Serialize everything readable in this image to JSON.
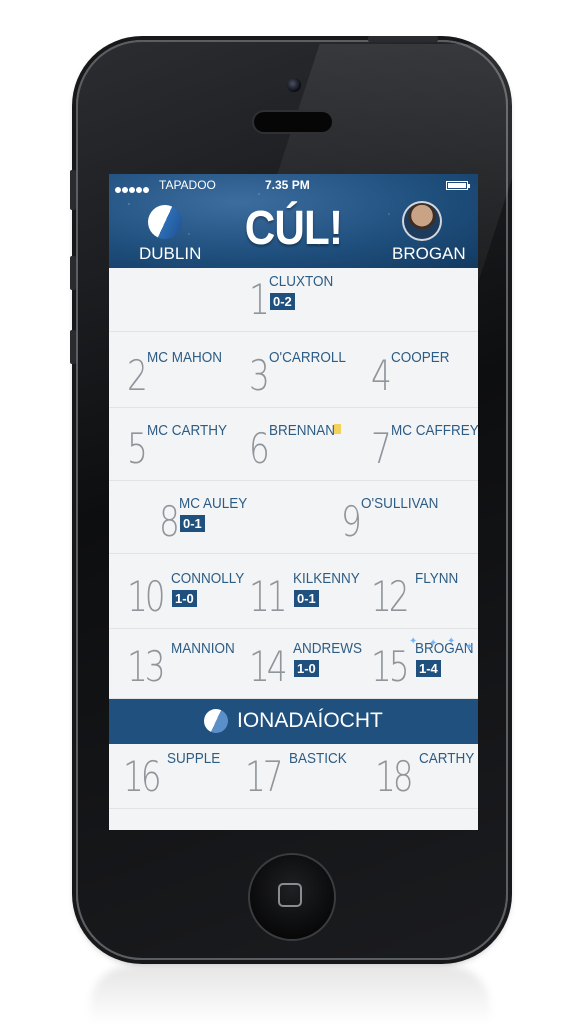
{
  "status": {
    "carrier": "TAPADOO",
    "time": "7.35 PM"
  },
  "header": {
    "title": "CÚL!",
    "team": "DUBLIN",
    "player": "BROGAN"
  },
  "lineup": [
    [
      {
        "n": "1",
        "name": "CLUXTON",
        "score": "0-2"
      }
    ],
    [
      {
        "n": "2",
        "name": "MC MAHON"
      },
      {
        "n": "3",
        "name": "O'CARROLL"
      },
      {
        "n": "4",
        "name": "COOPER"
      }
    ],
    [
      {
        "n": "5",
        "name": "MC CARTHY"
      },
      {
        "n": "6",
        "name": "BRENNAN",
        "card": "yellow"
      },
      {
        "n": "7",
        "name": "MC CAFFREY"
      }
    ],
    [
      {
        "n": "8",
        "name": "MC AULEY",
        "score": "0-1"
      },
      {
        "n": "9",
        "name": "O'SULLIVAN"
      }
    ],
    [
      {
        "n": "10",
        "name": "CONNOLLY",
        "score": "1-0"
      },
      {
        "n": "11",
        "name": "KILKENNY",
        "score": "0-1"
      },
      {
        "n": "12",
        "name": "FLYNN"
      }
    ],
    [
      {
        "n": "13",
        "name": "MANNION"
      },
      {
        "n": "14",
        "name": "ANDREWS",
        "score": "1-0"
      },
      {
        "n": "15",
        "name": "BROGAN",
        "score": "1-4",
        "highlight": true
      }
    ]
  ],
  "subs_label": "IONADAÍOCHT",
  "subs": [
    {
      "n": "16",
      "name": "SUPPLE"
    },
    {
      "n": "17",
      "name": "BASTICK"
    },
    {
      "n": "18",
      "name": "CARTHY"
    }
  ],
  "colors": {
    "brand": "#20507e",
    "card": "#f3d25a"
  },
  "icons": {
    "team": "dublin-crest-icon",
    "player": "player-avatar",
    "subs": "dublin-crest-icon"
  }
}
